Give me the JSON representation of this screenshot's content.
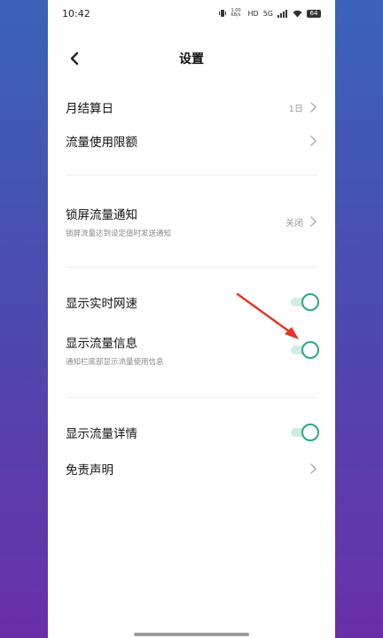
{
  "status_bar": {
    "time": "10:42",
    "network_speed": "1.00 KB/s",
    "hd_badge": "HD",
    "cell_badge": "5G",
    "battery": "64"
  },
  "header": {
    "title": "设置"
  },
  "rows": {
    "billing_day": {
      "title": "月结算日",
      "value": "1日"
    },
    "data_limit": {
      "title": "流量使用限额"
    },
    "lockscreen_notice": {
      "title": "锁屏流量通知",
      "subtitle": "锁屏流量达到设定值时发送通知",
      "value": "关闭"
    },
    "realtime_speed": {
      "title": "显示实时网速",
      "enabled": true
    },
    "traffic_info": {
      "title": "显示流量信息",
      "subtitle": "通知栏底部显示流量使用信息",
      "enabled": true
    },
    "traffic_details": {
      "title": "显示流量详情",
      "enabled": true
    },
    "disclaimer": {
      "title": "免责声明"
    }
  },
  "colors": {
    "accent": "#2aa888",
    "annotation_arrow": "#e8332a"
  }
}
